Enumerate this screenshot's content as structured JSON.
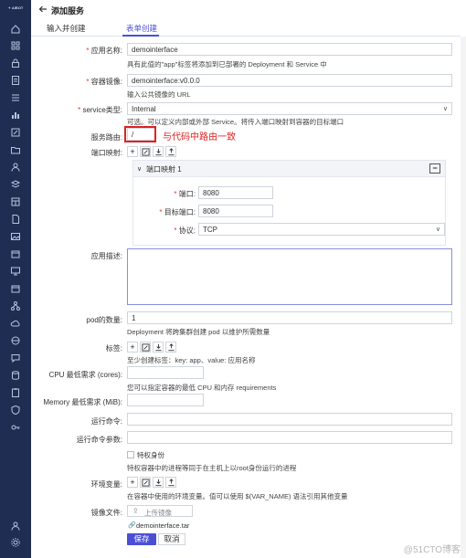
{
  "sidebar": {
    "logo_text": "✦ AIBOT"
  },
  "header": {
    "title": "添加服务"
  },
  "tabs": [
    {
      "label": "输入并创建"
    },
    {
      "label": "表单创建"
    }
  ],
  "form": {
    "app_name": {
      "label": "应用名称:",
      "value": "demointerface",
      "hint": "具有此值的\"app\"标签将添加到已部署的 Deployment 和 Service 中"
    },
    "image": {
      "label": "容器镜像:",
      "value": "demointerface:v0.0.0",
      "hint": "输入公共镜像的 URL"
    },
    "service_type": {
      "label": "service类型:",
      "value": "Internal",
      "hint": "可选。可以定义内部或外部 Service。将传入端口映射到容器的目标端口"
    },
    "route": {
      "label": "服务路由:",
      "value": "/"
    },
    "port_map": {
      "label": "端口映射:",
      "panel_title": "端口映射 1",
      "port_label": "端口:",
      "port_value": "8080",
      "target_label": "目标端口:",
      "target_value": "8080",
      "protocol_label": "协议:",
      "protocol_value": "TCP"
    },
    "description": {
      "label": "应用描述:"
    },
    "pods": {
      "label": "pod的数量:",
      "value": "1",
      "hint": "Deployment 将跨集群创建 pod 以维护所需数量"
    },
    "tags": {
      "label": "标签:",
      "hint": "至少创建标签：key: app、value: 应用名称"
    },
    "cpu": {
      "label": "CPU 最低需求 (cores):",
      "hint": "您可以指定容器的最低 CPU 和内存 requirements"
    },
    "memory": {
      "label": "Memory 最低需求 (MiB):"
    },
    "run_cmd": {
      "label": "运行命令:"
    },
    "run_args": {
      "label": "运行命令参数:"
    },
    "privileged": {
      "label": "特权身份",
      "hint": "特权容器中的进程等同于在主机上以root身份运行的进程"
    },
    "env": {
      "label": "环境变量:",
      "hint": "在容器中使用的环境变量。值可以使用 $(VAR_NAME) 语法引用其他变量"
    },
    "image_file": {
      "label": "镜像文件:",
      "upload_label": "上传镜像",
      "file_name": "demointerface.tar"
    }
  },
  "actions": {
    "save": "保存",
    "cancel": "取消"
  },
  "annotation": {
    "text": "与代码中路由一致"
  },
  "watermark": "@51CTO博客",
  "colors": {
    "sidebar": "#1f2d52",
    "accent": "#4b4fd6",
    "annotation": "#e02020"
  }
}
